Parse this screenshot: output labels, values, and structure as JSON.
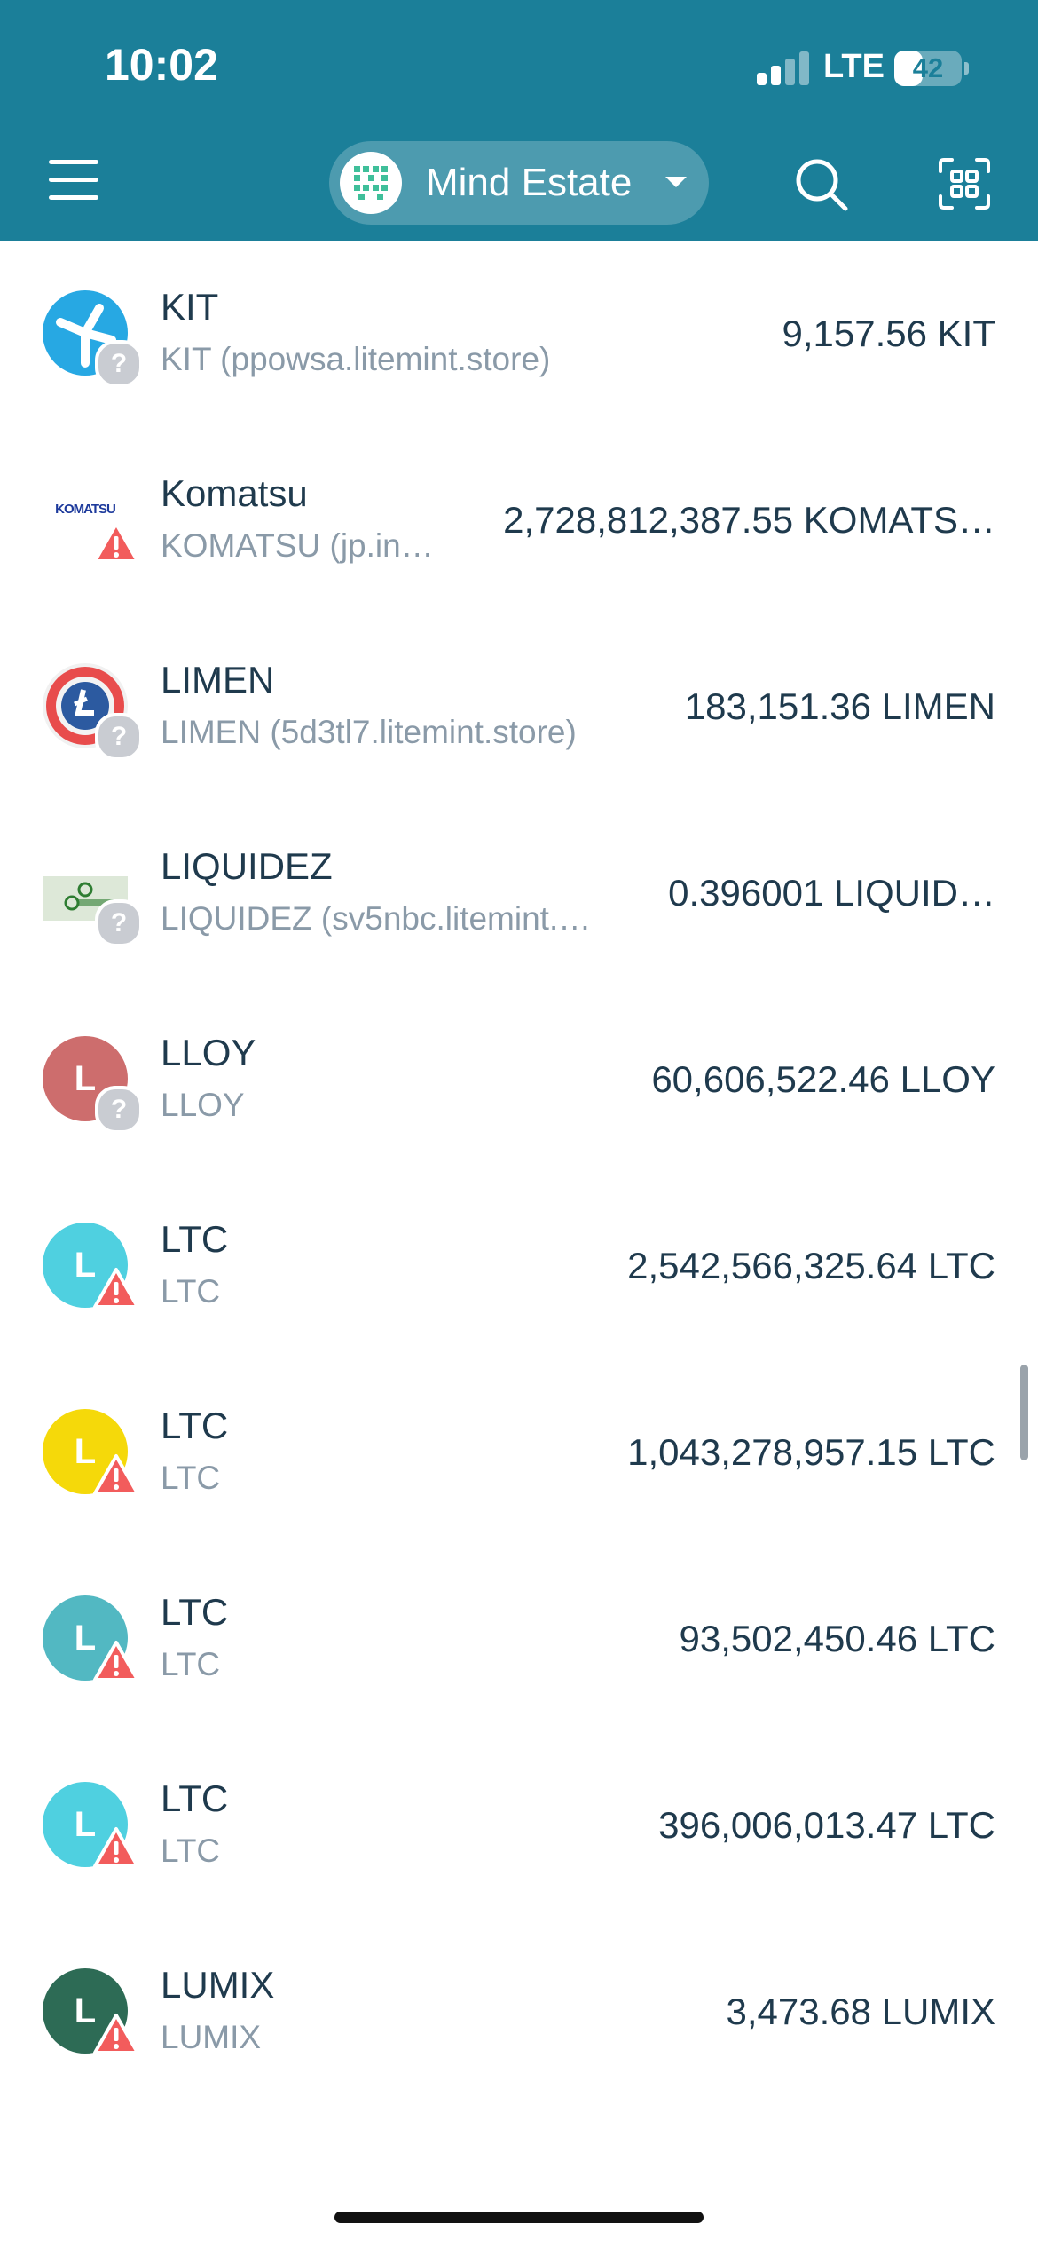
{
  "status_bar": {
    "time": "10:02",
    "network": "LTE",
    "battery": "42",
    "battery_level": 0.42
  },
  "header": {
    "wallet_name": "Mind Estate",
    "accent_color": "#1b7f99"
  },
  "tokens": [
    {
      "name": "KIT",
      "subtitle": "KIT (ppowsa.litemint.store)",
      "balance": "9,157.56 KIT",
      "logo": "kit-logo",
      "badge": "unknown"
    },
    {
      "name": "Komatsu",
      "subtitle": "KOMATSU (jp.in…",
      "balance": "2,728,812,387.55 KOMATS…",
      "logo": "komatsu-logo",
      "logo_text": "KOMATSU",
      "badge": "warning"
    },
    {
      "name": "LIMEN",
      "subtitle": "LIMEN (5d3tl7.litemint.store)",
      "balance": "183,151.36 LIMEN",
      "logo": "limen-logo",
      "badge": "unknown"
    },
    {
      "name": "LIQUIDEZ",
      "subtitle": "LIQUIDEZ (sv5nbc.litemint.…",
      "balance": "0.396001 LIQUID…",
      "logo": "liquidez-logo",
      "badge": "unknown"
    },
    {
      "name": "LLOY",
      "subtitle": "LLOY",
      "balance": "60,606,522.46 LLOY",
      "logo": "letter",
      "letter": "L",
      "color": "#cd6d6d",
      "badge": "unknown"
    },
    {
      "name": "LTC",
      "subtitle": "LTC",
      "balance": "2,542,566,325.64 LTC",
      "logo": "letter",
      "letter": "L",
      "color": "#4fd0e0",
      "badge": "warning"
    },
    {
      "name": "LTC",
      "subtitle": "LTC",
      "balance": "1,043,278,957.15 LTC",
      "logo": "letter",
      "letter": "L",
      "color": "#f5d90a",
      "badge": "warning"
    },
    {
      "name": "LTC",
      "subtitle": "LTC",
      "balance": "93,502,450.46 LTC",
      "logo": "letter",
      "letter": "L",
      "color": "#52b8c2",
      "badge": "warning"
    },
    {
      "name": "LTC",
      "subtitle": "LTC",
      "balance": "396,006,013.47 LTC",
      "logo": "letter",
      "letter": "L",
      "color": "#4fd0e0",
      "badge": "warning"
    },
    {
      "name": "LUMIX",
      "subtitle": "LUMIX",
      "balance": "3,473.68 LUMIX",
      "logo": "letter",
      "letter": "L",
      "color": "#2d6b55",
      "badge": "warning"
    }
  ],
  "colors": {
    "warning": "#f25c5c",
    "unknown": "#c9ccd2",
    "header_bg": "#1b7f99"
  }
}
